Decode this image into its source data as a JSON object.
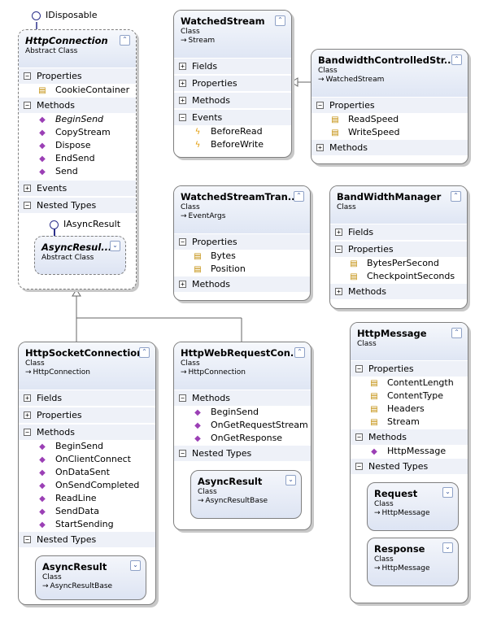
{
  "diagram": {
    "interfaces": {
      "idisposable": "IDisposable",
      "iasyncresult": "IAsyncResult"
    },
    "classes": {
      "http_connection": {
        "name": "HttpConnection",
        "kind": "Abstract Class",
        "sections": {
          "properties": "Properties",
          "methods": "Methods",
          "events": "Events",
          "nested": "Nested Types"
        },
        "properties": [
          "CookieContainer"
        ],
        "methods": [
          "BeginSend",
          "CopyStream",
          "Dispose",
          "EndSend",
          "Send"
        ],
        "nested": {
          "name": "AsyncResul...",
          "kind": "Abstract Class"
        }
      },
      "watched_stream": {
        "name": "WatchedStream",
        "kind": "Class",
        "base": "Stream",
        "sections": {
          "fields": "Fields",
          "properties": "Properties",
          "methods": "Methods",
          "events": "Events"
        },
        "events": [
          "BeforeRead",
          "BeforeWrite"
        ]
      },
      "bandwidth_controlled_stream": {
        "name": "BandwidthControlledStr...",
        "kind": "Class",
        "base": "WatchedStream",
        "sections": {
          "properties": "Properties",
          "methods": "Methods"
        },
        "properties": [
          "ReadSpeed",
          "WriteSpeed"
        ]
      },
      "watched_stream_tran": {
        "name": "WatchedStreamTran...",
        "kind": "Class",
        "base": "EventArgs",
        "sections": {
          "properties": "Properties",
          "methods": "Methods"
        },
        "properties": [
          "Bytes",
          "Position"
        ]
      },
      "bandwidth_manager": {
        "name": "BandWidthManager",
        "kind": "Class",
        "sections": {
          "fields": "Fields",
          "properties": "Properties",
          "methods": "Methods"
        },
        "properties": [
          "BytesPerSecond",
          "CheckpointSeconds"
        ]
      },
      "http_socket_connection": {
        "name": "HttpSocketConnection",
        "kind": "Class",
        "base": "HttpConnection",
        "sections": {
          "fields": "Fields",
          "properties": "Properties",
          "methods": "Methods",
          "nested": "Nested Types"
        },
        "methods": [
          "BeginSend",
          "OnClientConnect",
          "OnDataSent",
          "OnSendCompleted",
          "ReadLine",
          "SendData",
          "StartSending"
        ],
        "nested": {
          "name": "AsyncResult",
          "kind": "Class",
          "base": "AsyncResultBase"
        }
      },
      "http_webrequest_connection": {
        "name": "HttpWebRequestCon...",
        "kind": "Class",
        "base": "HttpConnection",
        "sections": {
          "methods": "Methods",
          "nested": "Nested Types"
        },
        "methods": [
          "BeginSend",
          "OnGetRequestStream",
          "OnGetResponse"
        ],
        "nested": {
          "name": "AsyncResult",
          "kind": "Class",
          "base": "AsyncResultBase"
        }
      },
      "http_message": {
        "name": "HttpMessage",
        "kind": "Class",
        "sections": {
          "properties": "Properties",
          "methods": "Methods",
          "nested": "Nested Types"
        },
        "properties": [
          "ContentLength",
          "ContentType",
          "Headers",
          "Stream"
        ],
        "methods": [
          "HttpMessage"
        ],
        "nested": [
          {
            "name": "Request",
            "kind": "Class",
            "base": "HttpMessage"
          },
          {
            "name": "Response",
            "kind": "Class",
            "base": "HttpMessage"
          }
        ]
      }
    },
    "icons": {
      "collapse": "double-chevron-up-icon",
      "expand": "double-chevron-down-icon",
      "section_expanded": "minus-box-icon",
      "section_collapsed": "plus-box-icon",
      "method": "method-icon",
      "private_method": "private-method-icon",
      "property": "property-icon",
      "event": "event-icon",
      "inherits": "inherits-arrow-icon"
    },
    "glyphs": {
      "minus": "−",
      "plus": "+",
      "collapse": "⌃",
      "expand": "⌄",
      "arrow": "→",
      "method": "◆",
      "property": "▤",
      "event": "ϟ"
    }
  }
}
